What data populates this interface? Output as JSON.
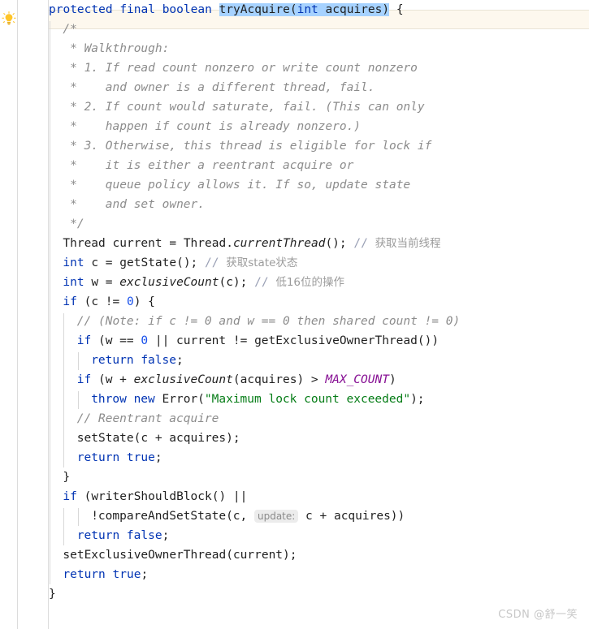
{
  "editor": {
    "language": "Java",
    "current_line_number": 1,
    "gutter_icon": "lightbulb-icon",
    "gutter_icon_tooltip": "Show context actions",
    "selection_text": "tryAcquire(int acquires)",
    "font_size_px": 14.5,
    "line_height_px": 24,
    "colors": {
      "background": "#ffffff",
      "current_line_highlight": "#fdf8ee",
      "selection": "#a6d2ff",
      "keyword": "#0033b3",
      "number": "#1750eb",
      "string": "#067d17",
      "comment": "#8c8c8c",
      "static_field": "#871094",
      "identifier": "#1f1f1f",
      "gutter_border": "#dcdcdc",
      "indent_guide": "#d8d8d8",
      "inlay_hint_bg": "#ececec",
      "inlay_hint_fg": "#8a8a8a"
    },
    "inlay_hints": [
      {
        "label": "update:",
        "on_line": 34
      }
    ]
  },
  "code": {
    "lines": [
      {
        "n": 1,
        "indent": 0,
        "highlight": true,
        "tokens": [
          {
            "t": "protected",
            "c": "kw"
          },
          {
            "t": " ",
            "c": "punct"
          },
          {
            "t": "final",
            "c": "kw"
          },
          {
            "t": " ",
            "c": "punct"
          },
          {
            "t": "boolean",
            "c": "kw"
          },
          {
            "t": " ",
            "c": "punct"
          },
          {
            "t": "tryAcquire",
            "c": "id sel"
          },
          {
            "t": "(",
            "c": "punct sel"
          },
          {
            "t": "int",
            "c": "kw sel"
          },
          {
            "t": " ",
            "c": "punct sel"
          },
          {
            "t": "acquires",
            "c": "id sel"
          },
          {
            "t": ")",
            "c": "punct sel"
          },
          {
            "t": " {",
            "c": "punct"
          }
        ]
      },
      {
        "n": 2,
        "indent": 1,
        "tokens": [
          {
            "t": "/*",
            "c": "cmt"
          }
        ]
      },
      {
        "n": 3,
        "indent": 1,
        "tokens": [
          {
            "t": " * Walkthrough:",
            "c": "cmt"
          }
        ]
      },
      {
        "n": 4,
        "indent": 1,
        "tokens": [
          {
            "t": " * 1. If read count nonzero or write count nonzero",
            "c": "cmt"
          }
        ]
      },
      {
        "n": 5,
        "indent": 1,
        "tokens": [
          {
            "t": " *    and owner is a different thread, fail.",
            "c": "cmt"
          }
        ]
      },
      {
        "n": 6,
        "indent": 1,
        "tokens": [
          {
            "t": " * 2. If count would saturate, fail. (This can only",
            "c": "cmt"
          }
        ]
      },
      {
        "n": 7,
        "indent": 1,
        "tokens": [
          {
            "t": " *    happen if count is already nonzero.)",
            "c": "cmt"
          }
        ]
      },
      {
        "n": 8,
        "indent": 1,
        "tokens": [
          {
            "t": " * 3. Otherwise, this thread is eligible for lock if",
            "c": "cmt"
          }
        ]
      },
      {
        "n": 9,
        "indent": 1,
        "tokens": [
          {
            "t": " *    it is either a reentrant acquire or",
            "c": "cmt"
          }
        ]
      },
      {
        "n": 10,
        "indent": 1,
        "tokens": [
          {
            "t": " *    queue policy allows it. If so, update state",
            "c": "cmt"
          }
        ]
      },
      {
        "n": 11,
        "indent": 1,
        "tokens": [
          {
            "t": " *    and set owner.",
            "c": "cmt"
          }
        ]
      },
      {
        "n": 12,
        "indent": 1,
        "tokens": [
          {
            "t": " */",
            "c": "cmt"
          }
        ]
      },
      {
        "n": 13,
        "indent": 1,
        "tokens": [
          {
            "t": "Thread",
            "c": "id"
          },
          {
            "t": " current = ",
            "c": "punct"
          },
          {
            "t": "Thread",
            "c": "id"
          },
          {
            "t": ".",
            "c": "punct"
          },
          {
            "t": "currentThread",
            "c": "smth"
          },
          {
            "t": "(); ",
            "c": "punct"
          },
          {
            "t": "// ",
            "c": "cmtslash"
          },
          {
            "t": "获取当前线程",
            "c": "cmtcn"
          }
        ]
      },
      {
        "n": 14,
        "indent": 1,
        "tokens": [
          {
            "t": "int",
            "c": "kw"
          },
          {
            "t": " c = ",
            "c": "punct"
          },
          {
            "t": "getState",
            "c": "id"
          },
          {
            "t": "(); ",
            "c": "punct"
          },
          {
            "t": "// ",
            "c": "cmtslash"
          },
          {
            "t": "获取state状态",
            "c": "cmtcn"
          }
        ]
      },
      {
        "n": 15,
        "indent": 1,
        "tokens": [
          {
            "t": "int",
            "c": "kw"
          },
          {
            "t": " w = ",
            "c": "punct"
          },
          {
            "t": "exclusiveCount",
            "c": "smth"
          },
          {
            "t": "(c); ",
            "c": "punct"
          },
          {
            "t": "// ",
            "c": "cmtslash"
          },
          {
            "t": "低16位的操作",
            "c": "cmtcn"
          }
        ]
      },
      {
        "n": 16,
        "indent": 1,
        "tokens": [
          {
            "t": "if",
            "c": "kw"
          },
          {
            "t": " (c != ",
            "c": "punct"
          },
          {
            "t": "0",
            "c": "num"
          },
          {
            "t": ") {",
            "c": "punct"
          }
        ]
      },
      {
        "n": 17,
        "indent": 2,
        "tokens": [
          {
            "t": "// (Note: if c != 0 and w == 0 then shared count != 0)",
            "c": "cmt"
          }
        ]
      },
      {
        "n": 18,
        "indent": 2,
        "tokens": [
          {
            "t": "if",
            "c": "kw"
          },
          {
            "t": " (w == ",
            "c": "punct"
          },
          {
            "t": "0",
            "c": "num"
          },
          {
            "t": " || current != ",
            "c": "punct"
          },
          {
            "t": "getExclusiveOwnerThread",
            "c": "id"
          },
          {
            "t": "())",
            "c": "punct"
          }
        ]
      },
      {
        "n": 19,
        "indent": 3,
        "tokens": [
          {
            "t": "return",
            "c": "kw"
          },
          {
            "t": " ",
            "c": "punct"
          },
          {
            "t": "false",
            "c": "kw"
          },
          {
            "t": ";",
            "c": "punct"
          }
        ]
      },
      {
        "n": 20,
        "indent": 2,
        "tokens": [
          {
            "t": "if",
            "c": "kw"
          },
          {
            "t": " (w + ",
            "c": "punct"
          },
          {
            "t": "exclusiveCount",
            "c": "smth"
          },
          {
            "t": "(acquires) > ",
            "c": "punct"
          },
          {
            "t": "MAX_COUNT",
            "c": "sfld"
          },
          {
            "t": ")",
            "c": "punct"
          }
        ]
      },
      {
        "n": 21,
        "indent": 3,
        "tokens": [
          {
            "t": "throw",
            "c": "kw"
          },
          {
            "t": " ",
            "c": "punct"
          },
          {
            "t": "new",
            "c": "kw"
          },
          {
            "t": " ",
            "c": "punct"
          },
          {
            "t": "Error",
            "c": "id"
          },
          {
            "t": "(",
            "c": "punct"
          },
          {
            "t": "\"Maximum lock count exceeded\"",
            "c": "str"
          },
          {
            "t": ");",
            "c": "punct"
          }
        ]
      },
      {
        "n": 22,
        "indent": 2,
        "tokens": [
          {
            "t": "// Reentrant acquire",
            "c": "cmt"
          }
        ]
      },
      {
        "n": 23,
        "indent": 2,
        "tokens": [
          {
            "t": "setState",
            "c": "id"
          },
          {
            "t": "(c + acquires);",
            "c": "punct"
          }
        ]
      },
      {
        "n": 24,
        "indent": 2,
        "tokens": [
          {
            "t": "return",
            "c": "kw"
          },
          {
            "t": " ",
            "c": "punct"
          },
          {
            "t": "true",
            "c": "kw"
          },
          {
            "t": ";",
            "c": "punct"
          }
        ]
      },
      {
        "n": 25,
        "indent": 1,
        "tokens": [
          {
            "t": "}",
            "c": "punct"
          }
        ]
      },
      {
        "n": 26,
        "indent": 1,
        "tokens": [
          {
            "t": "if",
            "c": "kw"
          },
          {
            "t": " (",
            "c": "punct"
          },
          {
            "t": "writerShouldBlock",
            "c": "id"
          },
          {
            "t": "() ||",
            "c": "punct"
          }
        ]
      },
      {
        "n": 27,
        "indent": 3,
        "tokens": [
          {
            "t": "!",
            "c": "punct"
          },
          {
            "t": "compareAndSetState",
            "c": "id"
          },
          {
            "t": "(c, ",
            "c": "punct"
          },
          {
            "t": "update:",
            "c": "hint"
          },
          {
            "t": " c + acquires))",
            "c": "punct"
          }
        ]
      },
      {
        "n": 28,
        "indent": 2,
        "tokens": [
          {
            "t": "return",
            "c": "kw"
          },
          {
            "t": " ",
            "c": "punct"
          },
          {
            "t": "false",
            "c": "kw"
          },
          {
            "t": ";",
            "c": "punct"
          }
        ]
      },
      {
        "n": 29,
        "indent": 1,
        "tokens": [
          {
            "t": "setExclusiveOwnerThread",
            "c": "id"
          },
          {
            "t": "(current);",
            "c": "punct"
          }
        ]
      },
      {
        "n": 30,
        "indent": 1,
        "tokens": [
          {
            "t": "return",
            "c": "kw"
          },
          {
            "t": " ",
            "c": "punct"
          },
          {
            "t": "true",
            "c": "kw"
          },
          {
            "t": ";",
            "c": "punct"
          }
        ]
      },
      {
        "n": 31,
        "indent": 0,
        "tokens": [
          {
            "t": "}",
            "c": "punct"
          }
        ]
      }
    ]
  },
  "watermark": {
    "text": "CSDN @舒一笑"
  }
}
